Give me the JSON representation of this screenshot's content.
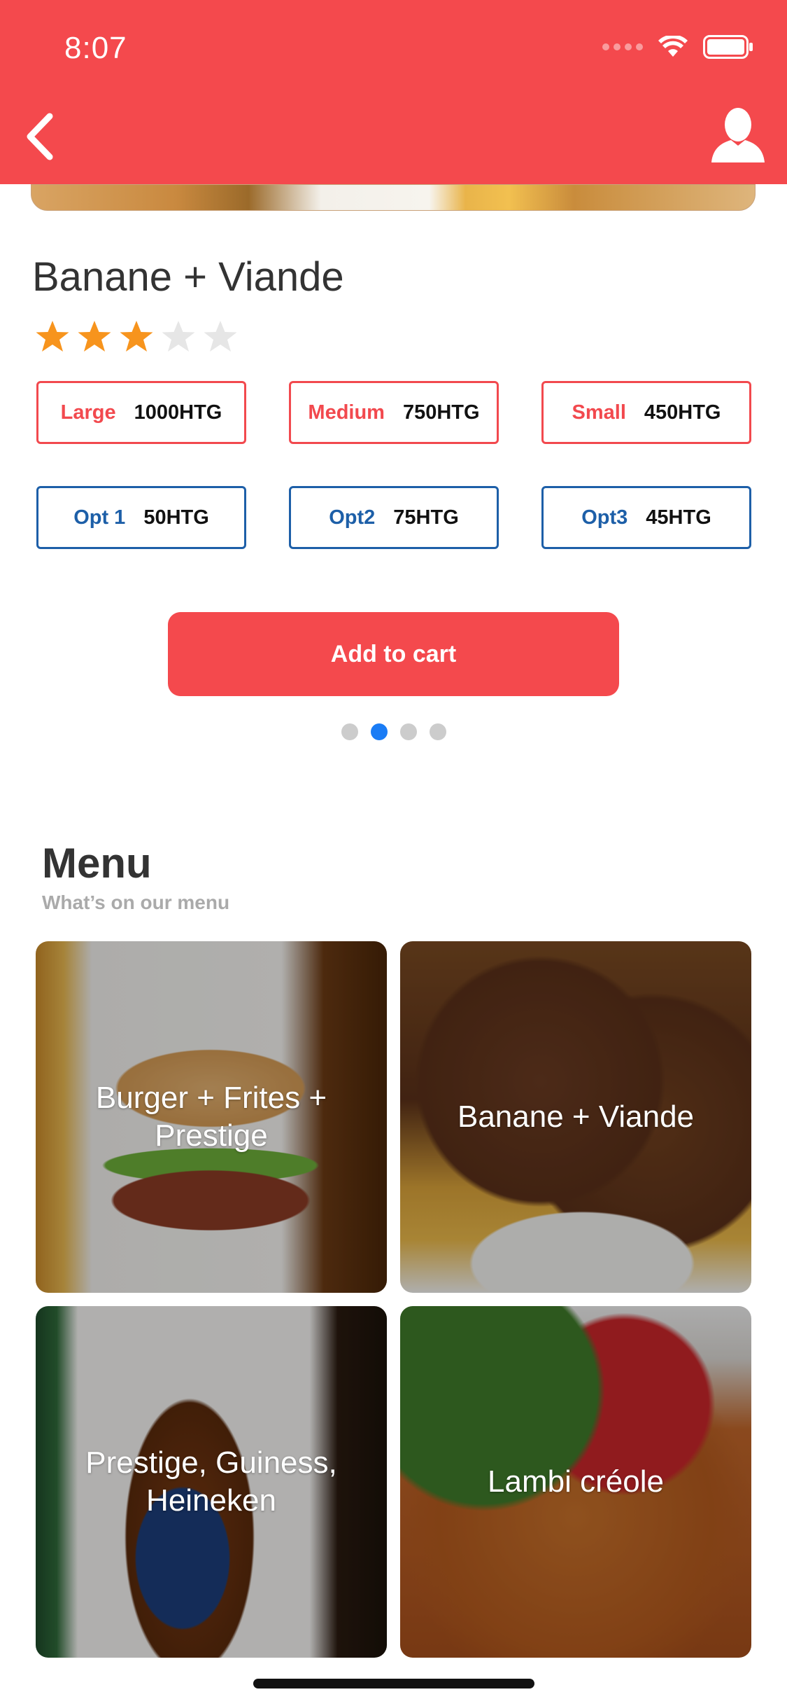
{
  "status_bar": {
    "time": "8:07"
  },
  "product": {
    "title": "Banane + Viande",
    "rating": 3,
    "rating_max": 5
  },
  "sizes": [
    {
      "label": "Large",
      "price": "1000HTG"
    },
    {
      "label": "Medium",
      "price": "750HTG"
    },
    {
      "label": "Small",
      "price": "450HTG"
    }
  ],
  "extras": [
    {
      "label": "Opt 1",
      "price": "50HTG"
    },
    {
      "label": "Opt2",
      "price": "75HTG"
    },
    {
      "label": "Opt3",
      "price": "45HTG"
    }
  ],
  "cart": {
    "label": "Add to cart"
  },
  "pager": {
    "count": 4,
    "active_index": 1
  },
  "menu": {
    "title": "Menu",
    "subtitle": "What’s on our menu",
    "items": [
      {
        "label": "Burger + Frites + Prestige"
      },
      {
        "label": "Banane + Viande"
      },
      {
        "label": "Prestige, Guiness, Heineken"
      },
      {
        "label": "Lambi créole"
      }
    ]
  },
  "colors": {
    "brand": "#f4494d",
    "size_accent": "#f2494e",
    "extra_accent": "#1d5fa8",
    "star_filled": "#f7941d",
    "star_empty": "#e6e6e6",
    "pager_active": "#1a7cf5"
  },
  "icons": {
    "back": "chevron-left-icon",
    "user": "user-icon",
    "wifi": "wifi-icon",
    "battery": "battery-icon",
    "star": "star-icon"
  }
}
